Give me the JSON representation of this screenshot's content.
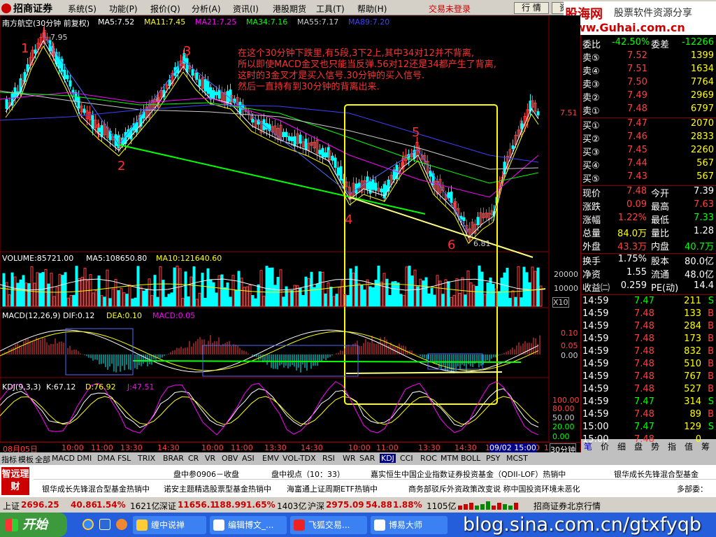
{
  "app": {
    "name": "招商证券"
  },
  "menu": [
    "系统(S)",
    "功能(P)",
    "报价(Q)",
    "分析(A)",
    "资讯(I)",
    "港股期货",
    "工具(T)",
    "帮助(H)"
  ],
  "trade_status": "交易未登录",
  "buttons": {
    "quote": "行 情",
    "info": "资 讯"
  },
  "banner": {
    "line1": "股海网",
    "line2": "股票软件资源分享",
    "line3": "www.Guhai.com.cn"
  },
  "chart": {
    "header": "南方航空(30分钟 前复权)",
    "ma": [
      {
        "label": "MA5:7.52",
        "color": "#ffffff"
      },
      {
        "label": "MA11:7.45",
        "color": "#ffff00"
      },
      {
        "label": "MA21:7.25",
        "color": "#ff00ff"
      },
      {
        "label": "MA34:7.16",
        "color": "#00ff00"
      },
      {
        "label": "MA55:7.17",
        "color": "#cccccc"
      },
      {
        "label": "MA89:7.20",
        "color": "#4040ff"
      }
    ],
    "high_label": "7.95",
    "low_label": "6.81",
    "price_tick": "7.51",
    "wave_labels": [
      "1",
      "2",
      "3",
      "4",
      "5",
      "6"
    ],
    "annotation": [
      "在这个30分钟下跌里,有5段,3下2上,其中34对12并不背离,",
      "所以即使MACD金叉也只能当反弹.56对12还是34都产生了背离,",
      "这时的3金叉才是买入信号.30分钟的买入信号.",
      "然后一直持有到30分钟的背离出来."
    ],
    "volume_header": [
      "VOLUME:85721.00",
      "MA5:108650.80",
      "MA10:121640.60"
    ],
    "volume_ticks": [
      "20000",
      "10000",
      "X10"
    ],
    "macd_header": [
      "MACD(12,26,9)",
      "DIF:0.12",
      "DEA:0.10",
      "MACD:0.05"
    ],
    "macd_ticks": [
      "0.10",
      "0.05",
      "0.00"
    ],
    "kdj_header": [
      "KDJ(9,3,3)",
      "K:67.12",
      "D:76.92",
      "J:47.51"
    ],
    "kdj_ticks": [
      "100.00",
      "80.00",
      "50.00",
      "20.00",
      "0.00"
    ],
    "time_axis": [
      "08月05日",
      "10:00",
      "11:00",
      "13:30",
      "14:30",
      "10:00",
      "11:00",
      "13:30",
      "14:30",
      "10:00",
      "11:00",
      "13:30",
      "14:30",
      "10:00",
      "11:00",
      "13",
      "09/02 15:00"
    ],
    "period": "30分钟"
  },
  "quote": {
    "weibi_label": "委比",
    "weibi": "-42.50%",
    "weicha_label": "委差",
    "weicha": "-12266",
    "asks": [
      {
        "label": "卖⑤",
        "price": "7.52",
        "vol": "1399"
      },
      {
        "label": "卖④",
        "price": "7.51",
        "vol": "1634"
      },
      {
        "label": "卖③",
        "price": "7.50",
        "vol": "7764"
      },
      {
        "label": "卖②",
        "price": "7.49",
        "vol": "2969"
      },
      {
        "label": "卖①",
        "price": "7.48",
        "vol": "6797"
      }
    ],
    "bids": [
      {
        "label": "买①",
        "price": "7.47",
        "vol": "2070"
      },
      {
        "label": "买②",
        "price": "7.46",
        "vol": "2833"
      },
      {
        "label": "买③",
        "price": "7.45",
        "vol": "2260"
      },
      {
        "label": "买④",
        "price": "7.44",
        "vol": "567"
      },
      {
        "label": "买⑤",
        "price": "7.43",
        "vol": "567"
      }
    ],
    "stats": [
      {
        "l1": "现价",
        "v1": "7.48",
        "c1": "#ff4040",
        "l2": "今开",
        "v2": "7.39",
        "c2": "#ffffff"
      },
      {
        "l1": "涨跌",
        "v1": "0.09",
        "c1": "#ff4040",
        "l2": "最高",
        "v2": "7.63",
        "c2": "#ff4040"
      },
      {
        "l1": "涨幅",
        "v1": "1.22%",
        "c1": "#ff4040",
        "l2": "最低",
        "v2": "7.33",
        "c2": "#00ff00"
      },
      {
        "l1": "总量",
        "v1": "84.0万",
        "c1": "#ffff00",
        "l2": "量比",
        "v2": "1.28",
        "c2": "#ffffff"
      },
      {
        "l1": "外盘",
        "v1": "43.3万",
        "c1": "#ff4040",
        "l2": "内盘",
        "v2": "40.7万",
        "c2": "#00ff00"
      }
    ],
    "stats2": [
      {
        "l1": "换手",
        "v1": "1.75%",
        "l2": "股本",
        "v2": "80.0亿"
      },
      {
        "l1": "净资",
        "v1": "1.55",
        "l2": "流通",
        "v2": "48.0亿"
      },
      {
        "l1": "收益㈡",
        "v1": "0.259",
        "l2": "PE(动)",
        "v2": "14.4"
      }
    ],
    "ticks": [
      {
        "t": "14:59",
        "p": "7.47",
        "v": "211",
        "s": "S"
      },
      {
        "t": "14:59",
        "p": "7.48",
        "v": "133",
        "s": "B"
      },
      {
        "t": "14:59",
        "p": "7.48",
        "v": "284",
        "s": "B"
      },
      {
        "t": "14:59",
        "p": "7.48",
        "v": "173",
        "s": "B"
      },
      {
        "t": "14:59",
        "p": "7.48",
        "v": "832",
        "s": "B"
      },
      {
        "t": "14:59",
        "p": "7.48",
        "v": "510",
        "s": "B"
      },
      {
        "t": "14:59",
        "p": "7.48",
        "v": "767",
        "s": "B"
      },
      {
        "t": "14:59",
        "p": "7.48",
        "v": "527",
        "s": "B"
      },
      {
        "t": "14:59",
        "p": "7.47",
        "v": "314",
        "s": "S"
      },
      {
        "t": "14:59",
        "p": "7.48",
        "v": "89",
        "s": "B"
      },
      {
        "t": "15:00",
        "p": "7.47",
        "v": "129",
        "s": "S"
      },
      {
        "t": "15:00",
        "p": "7.48",
        "v": "0",
        "s": ""
      }
    ],
    "tabs": [
      "笔",
      "价",
      "细",
      "盘",
      "势",
      "指",
      "值",
      "筹"
    ]
  },
  "bottom_tabs": [
    "指标",
    "模板",
    "全部",
    "MACD",
    "DMI",
    "DMA",
    "FSL",
    "TRIX",
    "BRAR",
    "CR",
    "VR",
    "OBV",
    "ASI",
    "EMV",
    "VOL-TDX",
    "RSI",
    "WR",
    "SAR",
    "KDJ",
    "CCI",
    "ROC",
    "MTM",
    "BOLL",
    "PSY",
    "MCST"
  ],
  "news": {
    "badge": "智远理财",
    "row1": [
      "盘中参0906－收盘",
      "盘中视点（10：33）",
      "嘉实恒生中国企业指数证券投资基金（QDII-LOF）热销中",
      "银华成长先锋混合型基金"
    ],
    "row2": [
      "银华成长先锋混合型基金热销中",
      "诺安主题精选股票型基金热销中",
      "海富通上证周期ETF热销中",
      "商务部驳斥外资政策改变说 称中国投资环境未恶化",
      "多部委："
    ]
  },
  "statusbar": {
    "sh_label": "上证",
    "sh_val": "2696.25",
    "sh_chg": "40.86",
    "sh_pct": "1.54%",
    "sh_amt": "1621亿",
    "sz_label": "深证",
    "sz_val": "11656.1",
    "sz_chg": "188.99",
    "sz_pct": "1.65%",
    "sz_amt": "1403亿",
    "hs_label": "沪深",
    "hs_val": "2975.09",
    "hs_chg": "54.88",
    "hs_pct": "1.88%",
    "hs_amt": "1105亿",
    "broker": "招商证券北京行情"
  },
  "taskbar": {
    "start": "开始",
    "tasks": [
      "缠中说禅",
      "编辑博文_...",
      "飞狐交易...",
      "博易大师"
    ],
    "watermark": "blog.sina.com.cn/gtxfyqb"
  }
}
